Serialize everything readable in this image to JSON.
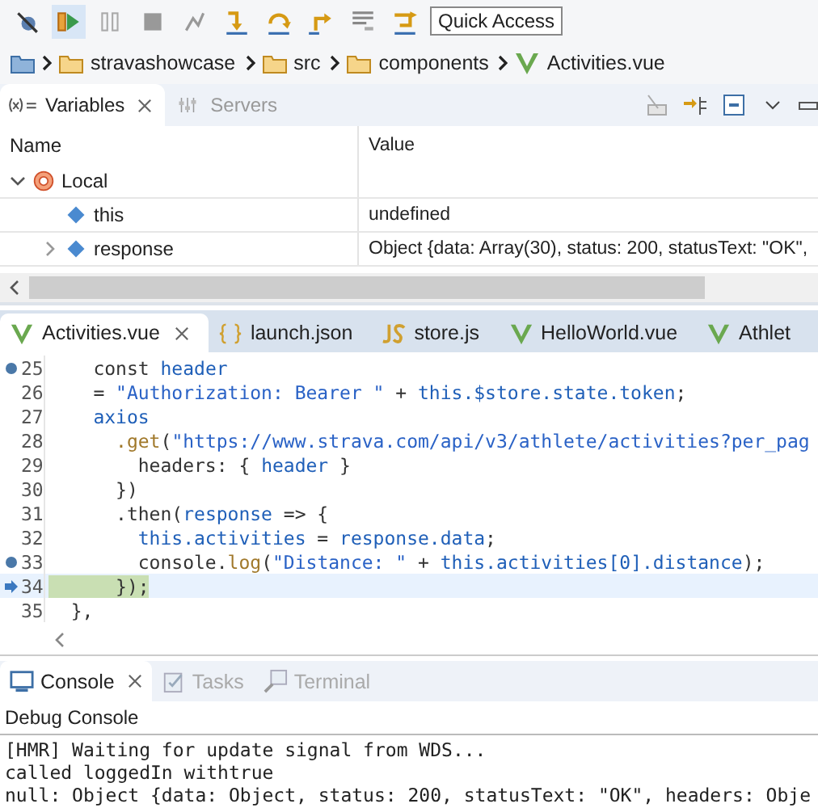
{
  "toolbar": {
    "quick_access": "Quick Access"
  },
  "breadcrumb": [
    "stravashowcase",
    "src",
    "components",
    "Activities.vue"
  ],
  "variables_view": {
    "tabs": [
      {
        "label": "Variables",
        "selected": true
      },
      {
        "label": "Servers",
        "selected": false
      }
    ],
    "columns": [
      "Name",
      "Value"
    ],
    "rows": [
      {
        "name": "Local",
        "value": "",
        "expanded": true,
        "children": [
          {
            "name": "this",
            "value": "undefined",
            "expandable": false
          },
          {
            "name": "response",
            "value": "Object {data: Array(30), status: 200, statusText: \"OK\",",
            "expandable": true
          }
        ]
      }
    ]
  },
  "editor": {
    "tabs": [
      {
        "label": "Activities.vue",
        "kind": "vue",
        "selected": true
      },
      {
        "label": "launch.json",
        "kind": "json",
        "selected": false
      },
      {
        "label": "store.js",
        "kind": "js",
        "selected": false
      },
      {
        "label": "HelloWorld.vue",
        "kind": "vue",
        "selected": false
      },
      {
        "label": "Athlet",
        "kind": "vue",
        "selected": false
      }
    ],
    "lines": [
      {
        "number": "25",
        "breakpoint": true,
        "current": false,
        "segments": [
          {
            "kind": "plain",
            "text": "    const "
          },
          {
            "kind": "ident",
            "text": "header"
          }
        ]
      },
      {
        "number": "26",
        "breakpoint": false,
        "current": false,
        "segments": [
          {
            "kind": "plain",
            "text": "    = "
          },
          {
            "kind": "string",
            "text": "\"Authorization: Bearer \""
          },
          {
            "kind": "plain",
            "text": " + "
          },
          {
            "kind": "ident",
            "text": "this.$store.state.token"
          },
          {
            "kind": "plain",
            "text": ";"
          }
        ]
      },
      {
        "number": "27",
        "breakpoint": false,
        "current": false,
        "segments": [
          {
            "kind": "ident",
            "text": "    axios"
          }
        ]
      },
      {
        "number": "28",
        "breakpoint": false,
        "current": false,
        "segments": [
          {
            "kind": "method",
            "text": "      .get"
          },
          {
            "kind": "plain",
            "text": "("
          },
          {
            "kind": "string",
            "text": "\"https://www.strava.com/api/v3/athlete/activities?per_pag"
          }
        ]
      },
      {
        "number": "29",
        "breakpoint": false,
        "current": false,
        "segments": [
          {
            "kind": "plain",
            "text": "        headers: { "
          },
          {
            "kind": "ident",
            "text": "header"
          },
          {
            "kind": "plain",
            "text": " }"
          }
        ]
      },
      {
        "number": "30",
        "breakpoint": false,
        "current": false,
        "segments": [
          {
            "kind": "plain",
            "text": "      })"
          }
        ]
      },
      {
        "number": "31",
        "breakpoint": false,
        "current": false,
        "segments": [
          {
            "kind": "plain",
            "text": "      .then("
          },
          {
            "kind": "ident",
            "text": "response"
          },
          {
            "kind": "plain",
            "text": " => {"
          }
        ]
      },
      {
        "number": "32",
        "breakpoint": false,
        "current": false,
        "segments": [
          {
            "kind": "ident",
            "text": "        this.activities"
          },
          {
            "kind": "plain",
            "text": " = "
          },
          {
            "kind": "ident",
            "text": "response.data"
          },
          {
            "kind": "plain",
            "text": ";"
          }
        ]
      },
      {
        "number": "33",
        "breakpoint": true,
        "current": false,
        "segments": [
          {
            "kind": "plain",
            "text": "        console."
          },
          {
            "kind": "method",
            "text": "log"
          },
          {
            "kind": "plain",
            "text": "("
          },
          {
            "kind": "string",
            "text": "\"Distance: \""
          },
          {
            "kind": "plain",
            "text": " + "
          },
          {
            "kind": "ident",
            "text": "this.activities[0].distance"
          },
          {
            "kind": "plain",
            "text": ");"
          }
        ]
      },
      {
        "number": "34",
        "breakpoint": false,
        "current": true,
        "segments": [
          {
            "kind": "plain",
            "text": "      });"
          }
        ]
      },
      {
        "number": "35",
        "breakpoint": false,
        "current": false,
        "segments": [
          {
            "kind": "plain",
            "text": "  },"
          }
        ]
      }
    ]
  },
  "console_view": {
    "tabs": [
      {
        "label": "Console",
        "selected": true
      },
      {
        "label": "Tasks",
        "selected": false
      },
      {
        "label": "Terminal",
        "selected": false
      }
    ],
    "title": "Debug Console",
    "lines": [
      "[HMR] Waiting for update signal from WDS...",
      "called loggedIn withtrue",
      "null: Object {data: Object, status: 200, statusText: \"OK\", headers: Obje"
    ]
  }
}
